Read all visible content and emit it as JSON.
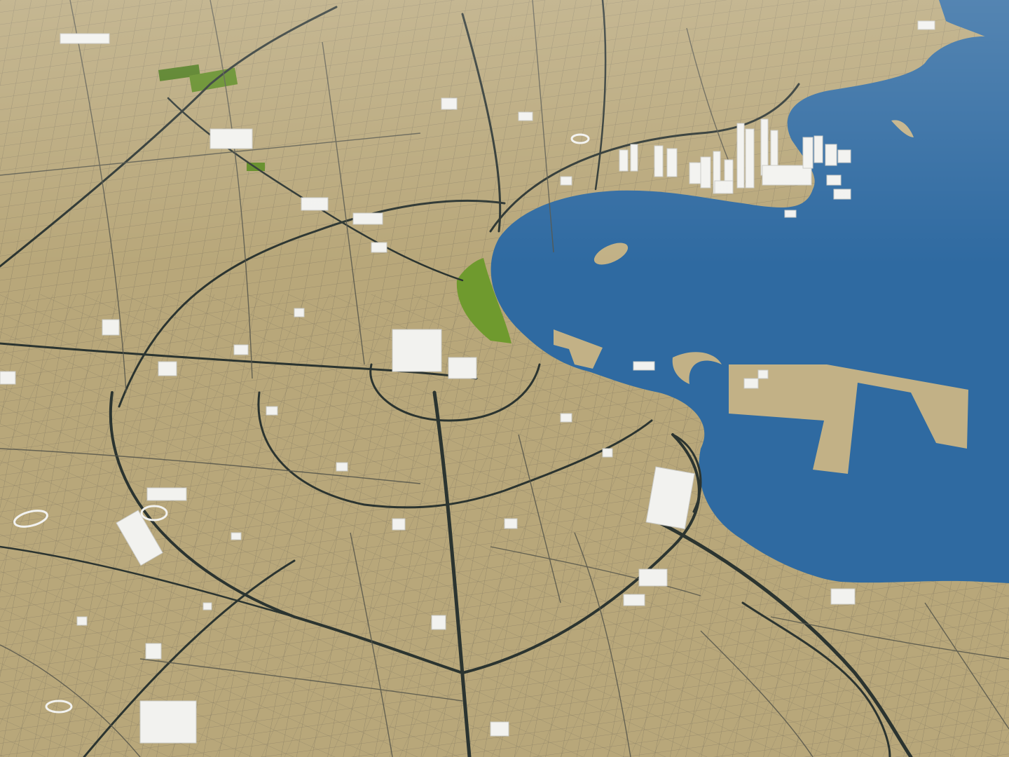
{
  "scene": {
    "type": "3d-city-model-map",
    "view": "oblique aerial",
    "labels_visible": false
  },
  "colors": {
    "land": "#b8a77a",
    "land_shade": "#ad9c6e",
    "water": "#2f6aa1",
    "water_edge": "#3a76ad",
    "road_major": "#2b3430",
    "road_minor": "#55554a",
    "building_top": "#f2f2ef",
    "building_side": "#c9c9c4",
    "park": "#6f9a2e",
    "park_dark": "#4f7a1c",
    "pier": "#c2b186"
  },
  "features": {
    "bay": "bay",
    "island": "small-island",
    "skyline": "high-rise-cluster",
    "port": "port-piers",
    "parks": "green-parks",
    "ring_roads": "ring-roads",
    "grid": "street-grid",
    "buildings": "low-rise-buildings",
    "stadium": "stadium-track"
  }
}
